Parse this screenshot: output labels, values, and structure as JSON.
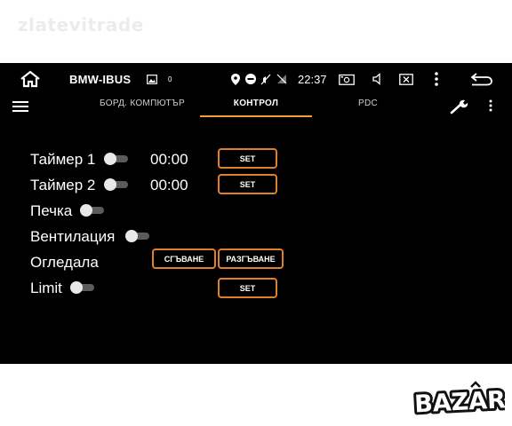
{
  "watermark": "zlatevitrade",
  "status_bar": {
    "app_title": "BMW-IBUS",
    "notification_count": "0",
    "time": "22:37",
    "icons": [
      "home-icon",
      "image-icon",
      "location-icon",
      "do-not-disturb-icon",
      "mute-icon",
      "no-signal-icon",
      "screenshot-icon",
      "volume-icon",
      "close-window-icon",
      "more-vertical-icon",
      "back-icon"
    ]
  },
  "tabs": [
    {
      "label": "БОРД. КОМПЮТЪР",
      "active": false
    },
    {
      "label": "КОНТРОЛ",
      "active": true
    },
    {
      "label": "PDC",
      "active": false
    }
  ],
  "controls": {
    "timer1": {
      "label": "Таймер 1",
      "time": "00:00",
      "button": "SET",
      "on": false
    },
    "timer2": {
      "label": "Таймер 2",
      "time": "00:00",
      "button": "SET",
      "on": false
    },
    "heater": {
      "label": "Печка",
      "on": false
    },
    "ventilation": {
      "label": "Вентилация",
      "on": false
    },
    "mirrors": {
      "label": "Огледала",
      "fold_button": "СГЪВАНЕ",
      "unfold_button": "РАЗГЪВАНЕ"
    },
    "limit": {
      "label": "Limit",
      "button": "SET",
      "on": false
    }
  },
  "colors": {
    "accent": "#e07f2a",
    "tab_indicator": "#f0a030",
    "background": "#000000"
  },
  "logo": "BAZAR"
}
